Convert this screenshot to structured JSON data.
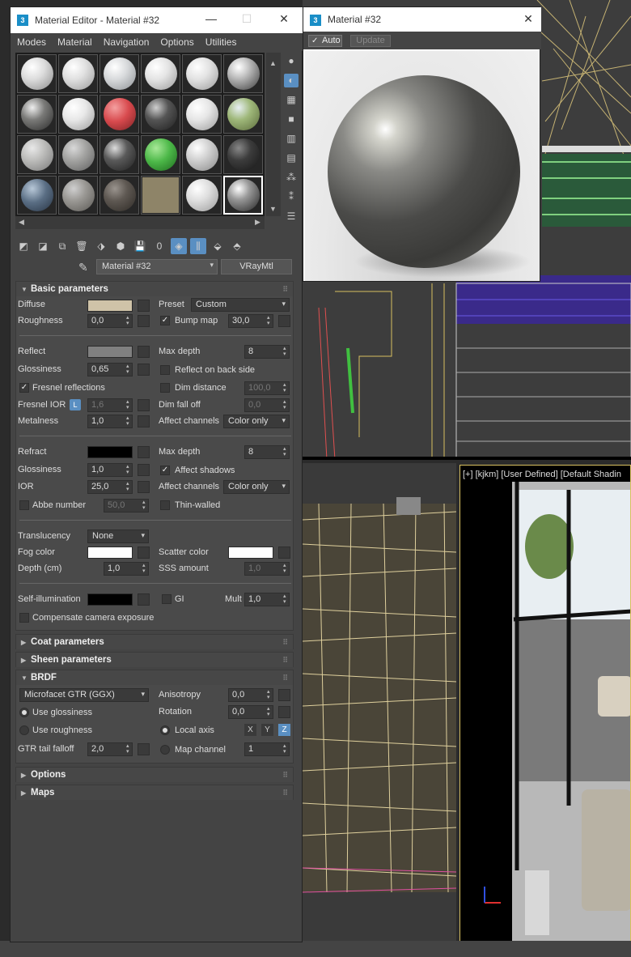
{
  "material_editor": {
    "title": "Material Editor - Material #32",
    "menu": [
      "Modes",
      "Material",
      "Navigation",
      "Options",
      "Utilities"
    ],
    "material_name": "Material #32",
    "material_type": "VRayMtl"
  },
  "preview": {
    "title": "Material #32",
    "auto_label": "Auto",
    "update_label": "Update"
  },
  "viewport": {
    "label": "[+] [kjkm] [User Defined] [Default Shadin"
  },
  "basic": {
    "title": "Basic parameters",
    "diffuse_label": "Diffuse",
    "diffuse_color": "#cfc3a8",
    "preset_label": "Preset",
    "preset_value": "Custom",
    "roughness_label": "Roughness",
    "roughness_value": "0,0",
    "bump_label": "Bump map",
    "bump_value": "30,0",
    "reflect_label": "Reflect",
    "reflect_color": "#808080",
    "max_depth_label": "Max depth",
    "max_depth_value": "8",
    "glossiness_label": "Glossiness",
    "glossiness_value": "0,65",
    "reflect_back_label": "Reflect on back side",
    "fresnel_label": "Fresnel reflections",
    "dim_distance_label": "Dim distance",
    "dim_distance_value": "100,0",
    "fresnel_ior_label": "Fresnel IOR",
    "l_label": "L",
    "fresnel_ior_value": "1,6",
    "dim_falloff_label": "Dim fall off",
    "dim_falloff_value": "0,0",
    "metalness_label": "Metalness",
    "metalness_value": "1,0",
    "affect_channels_label": "Affect channels",
    "affect_channels_value": "Color only",
    "refract_label": "Refract",
    "refract_color": "#000000",
    "refr_max_depth_label": "Max depth",
    "refr_max_depth_value": "8",
    "refr_glossiness_label": "Glossiness",
    "refr_glossiness_value": "1,0",
    "affect_shadows_label": "Affect shadows",
    "ior_label": "IOR",
    "ior_value": "25,0",
    "refr_affect_channels_label": "Affect channels",
    "refr_affect_channels_value": "Color only",
    "abbe_label": "Abbe number",
    "abbe_value": "50,0",
    "thin_walled_label": "Thin-walled",
    "translucency_label": "Translucency",
    "translucency_value": "None",
    "fog_color_label": "Fog color",
    "fog_color": "#ffffff",
    "scatter_color_label": "Scatter color",
    "scatter_color": "#ffffff",
    "depth_label": "Depth (cm)",
    "depth_value": "1,0",
    "sss_label": "SSS amount",
    "sss_value": "1,0",
    "self_illum_label": "Self-illumination",
    "self_illum_color": "#000000",
    "gi_label": "GI",
    "mult_label": "Mult",
    "mult_value": "1,0",
    "compensate_label": "Compensate camera exposure"
  },
  "coat": {
    "title": "Coat parameters"
  },
  "sheen": {
    "title": "Sheen parameters"
  },
  "brdf": {
    "title": "BRDF",
    "type_value": "Microfacet GTR (GGX)",
    "anisotropy_label": "Anisotropy",
    "anisotropy_value": "0,0",
    "use_glossiness_label": "Use glossiness",
    "rotation_label": "Rotation",
    "rotation_value": "0,0",
    "use_roughness_label": "Use roughness",
    "local_axis_label": "Local axis",
    "x_label": "X",
    "y_label": "Y",
    "z_label": "Z",
    "gtr_label": "GTR tail falloff",
    "gtr_value": "2,0",
    "map_channel_label": "Map channel",
    "map_channel_value": "1"
  },
  "options": {
    "title": "Options"
  },
  "maps": {
    "title": "Maps"
  },
  "slots": [
    {
      "fill": "radial-gradient(circle at 35% 30%,#fff,#dcdcdc 40%,#8a8a8a)"
    },
    {
      "fill": "radial-gradient(circle at 35% 30%,#fff,#e0e0e0 40%,#999)"
    },
    {
      "fill": "radial-gradient(circle at 35% 30%,#fff,#d8dadc 40%,#8c9094)"
    },
    {
      "fill": "radial-gradient(circle at 35% 30%,#fff,#e4e4e4 40%,#9a9a9a)"
    },
    {
      "fill": "radial-gradient(circle at 35% 30%,#fff,#e2e2e2 40%,#999)"
    },
    {
      "fill": "radial-gradient(circle at 35% 30%,#fff,#c8c8c8 30%,#3a3a3a)"
    },
    {
      "fill": "radial-gradient(circle at 35% 30%,#eee,#7a7a78 40%,#2a2a2a)"
    },
    {
      "fill": "radial-gradient(circle at 35% 30%,#fff,#e8e8e8 40%,#9a9a9a)"
    },
    {
      "fill": "radial-gradient(circle at 35% 30%,#f4a0a0,#d84a4e 45%,#7a2224)"
    },
    {
      "fill": "radial-gradient(circle at 35% 30%,#cfcfcf,#555 40%,#1e1e1e)"
    },
    {
      "fill": "radial-gradient(circle at 35% 30%,#fff,#e6e6e6 40%,#9a9a9a)"
    },
    {
      "fill": "radial-gradient(circle at 35% 30%,#e8f0f4,#9fb87a 40%,#5a6a3a)"
    },
    {
      "fill": "radial-gradient(circle at 35% 30%,#e8e8e8,#bdbdbb 40%,#777)"
    },
    {
      "fill": "radial-gradient(circle at 35% 30%,#d8d8d8,#a4a4a2 40%,#5e5e5e)"
    },
    {
      "fill": "radial-gradient(circle at 35% 30%,#ddd,#5a5a5a 40%,#1e1e1e)"
    },
    {
      "fill": "radial-gradient(circle at 35% 30%,#a8e898,#4cb848 45%,#1e6a1e)"
    },
    {
      "fill": "radial-gradient(circle at 35% 30%,#fff,#d0d0d0 40%,#888)"
    },
    {
      "fill": "radial-gradient(circle at 35% 30%,#888,#3c3c3c 40%,#161616)"
    },
    {
      "fill": "radial-gradient(circle at 35% 30%,#b8c8d8,#5a6e84 45%,#283444)"
    },
    {
      "fill": "radial-gradient(circle at 35% 30%,#cfcfcf,#9a9894 40%,#5a5854)"
    },
    {
      "fill": "radial-gradient(circle at 35% 30%,#9a948e,#5e5852 40%,#2e2a26)"
    },
    {
      "fill": "#8e8468"
    },
    {
      "fill": "radial-gradient(circle at 35% 30%,#fff,#dedede 40%,#9a9a9a)"
    },
    {
      "fill": "radial-gradient(circle at 35% 30%,#fff,#9a9a9a 35%,#222)"
    }
  ]
}
